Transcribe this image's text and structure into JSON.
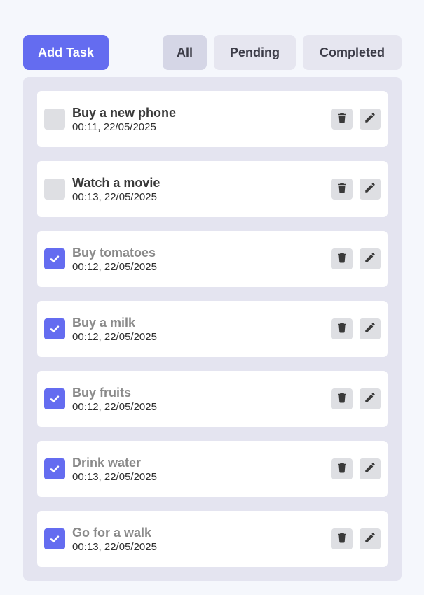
{
  "toolbar": {
    "add_label": "Add Task",
    "filters": [
      {
        "label": "All",
        "active": true
      },
      {
        "label": "Pending",
        "active": false
      },
      {
        "label": "Completed",
        "active": false
      }
    ]
  },
  "tasks": [
    {
      "title": "Buy a new phone",
      "time": "00:11, 22/05/2025",
      "completed": false
    },
    {
      "title": "Watch a movie",
      "time": "00:13, 22/05/2025",
      "completed": false
    },
    {
      "title": "Buy tomatoes",
      "time": "00:12, 22/05/2025",
      "completed": true
    },
    {
      "title": "Buy a milk",
      "time": "00:12, 22/05/2025",
      "completed": true
    },
    {
      "title": "Buy fruits",
      "time": "00:12, 22/05/2025",
      "completed": true
    },
    {
      "title": "Drink water",
      "time": "00:13, 22/05/2025",
      "completed": true
    },
    {
      "title": "Go for a walk",
      "time": "00:13, 22/05/2025",
      "completed": true
    }
  ],
  "icons": {
    "checkmark": "check-icon",
    "delete": "trash-icon",
    "edit": "pencil-icon"
  },
  "colors": {
    "accent": "#646cf0",
    "page_background": "#f5f7fc",
    "panel_background": "#e4e4f0",
    "filter_button": "#e6e6f0",
    "filter_button_active": "#d5d6e6",
    "icon_button": "#dedfe3"
  }
}
